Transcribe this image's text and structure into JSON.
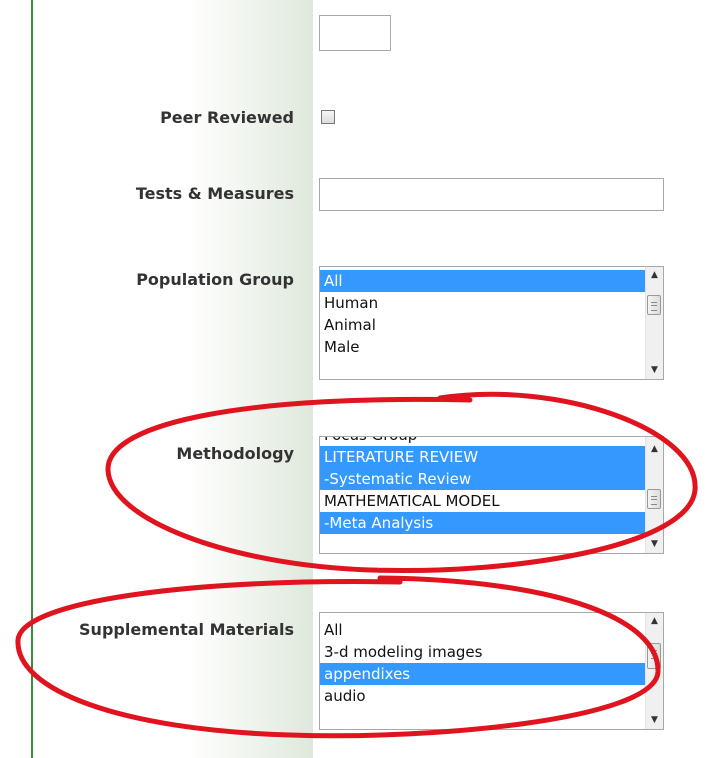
{
  "form": {
    "peer_reviewed": {
      "label": "Peer Reviewed",
      "checked": false
    },
    "tests_measures": {
      "label": "Tests & Measures",
      "value": "",
      "placeholder": ""
    },
    "top_field": {
      "value": ""
    },
    "population_group": {
      "label": "Population Group",
      "options": [
        "All",
        "Human",
        "Animal",
        "Male"
      ],
      "selected": [
        "All"
      ]
    },
    "methodology": {
      "label": "Methodology",
      "options": [
        "Focus Group",
        "LITERATURE REVIEW",
        "-Systematic Review",
        "MATHEMATICAL MODEL",
        "-Meta Analysis"
      ],
      "selected": [
        "LITERATURE REVIEW",
        "-Systematic Review",
        "-Meta Analysis"
      ]
    },
    "supplemental_materials": {
      "label": "Supplemental Materials",
      "options": [
        "All",
        "3-d modeling images",
        "appendixes",
        "audio"
      ],
      "selected": [
        "appendixes"
      ]
    }
  },
  "icons": {
    "scroll_up": "▲",
    "scroll_down": "▼"
  },
  "colors": {
    "selection": "#3399ff",
    "annotation": "#e0141e",
    "border_green": "#3c8a3c"
  }
}
